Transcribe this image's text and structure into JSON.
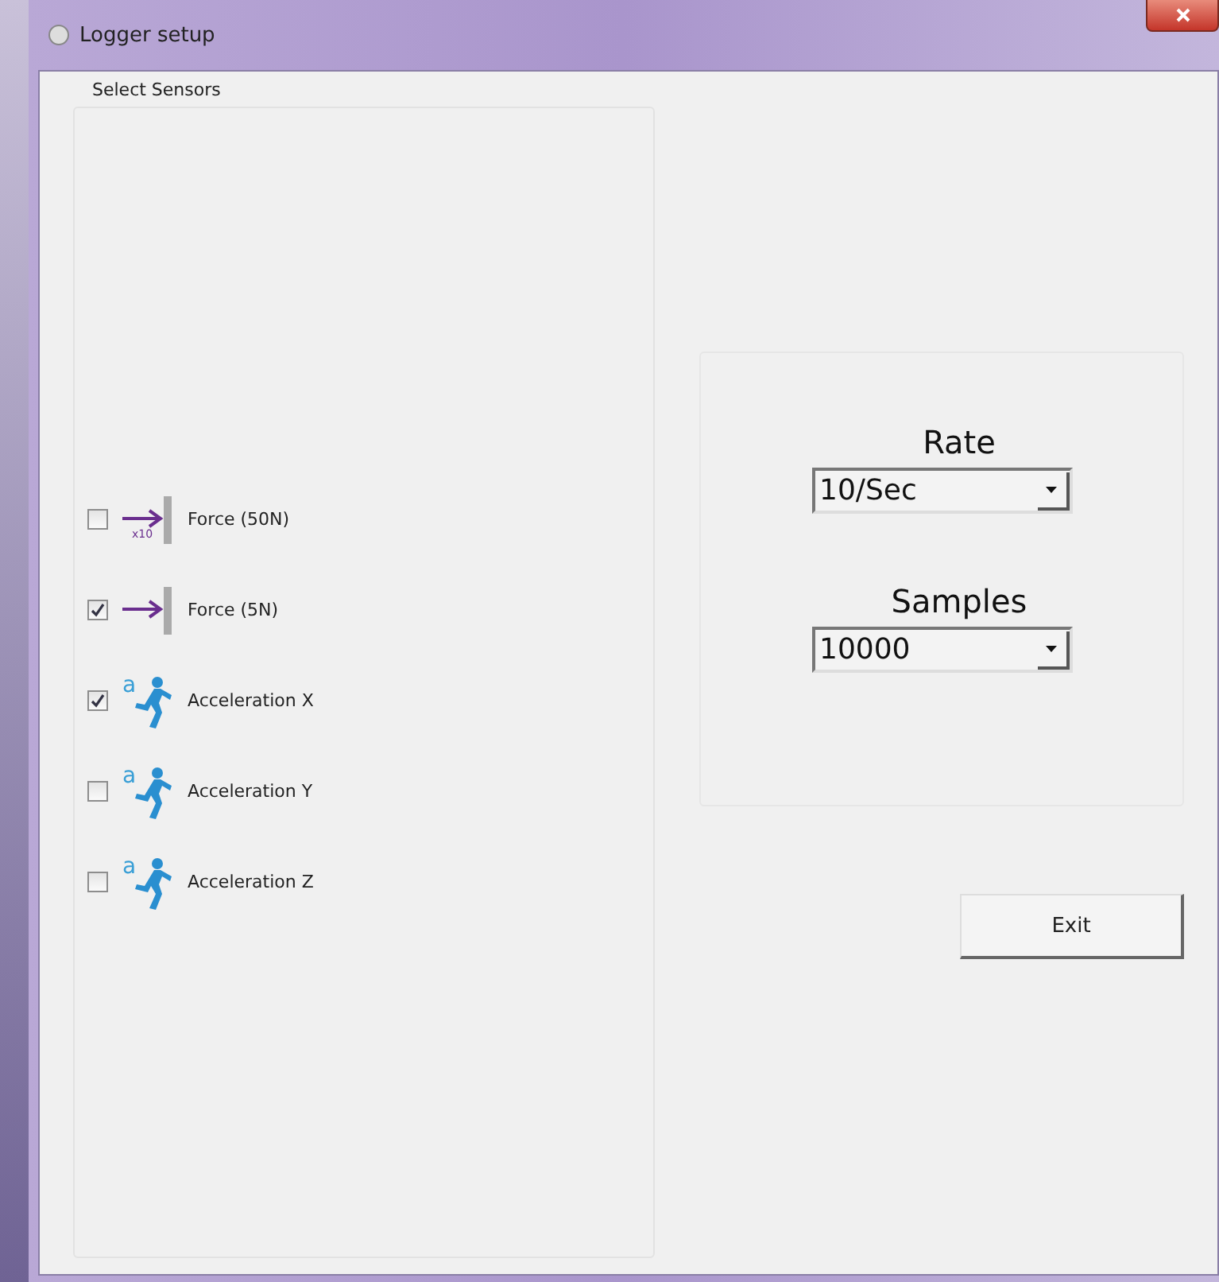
{
  "window": {
    "title": "Logger setup"
  },
  "sensors": {
    "title": "Select Sensors",
    "items": [
      {
        "kind": "force",
        "label": "Force (50N)",
        "checked": false,
        "icon_badge": "x10"
      },
      {
        "kind": "force",
        "label": "Force (5N)",
        "checked": true
      },
      {
        "kind": "acceleration",
        "label": "Acceleration X",
        "checked": true,
        "icon_letter": "a"
      },
      {
        "kind": "acceleration",
        "label": "Acceleration Y",
        "checked": false,
        "icon_letter": "a"
      },
      {
        "kind": "acceleration",
        "label": "Acceleration Z",
        "checked": false,
        "icon_letter": "a"
      }
    ]
  },
  "rate": {
    "label": "Rate",
    "value": "10/Sec"
  },
  "samples": {
    "label": "Samples",
    "value": "10000"
  },
  "buttons": [
    "Exit"
  ]
}
